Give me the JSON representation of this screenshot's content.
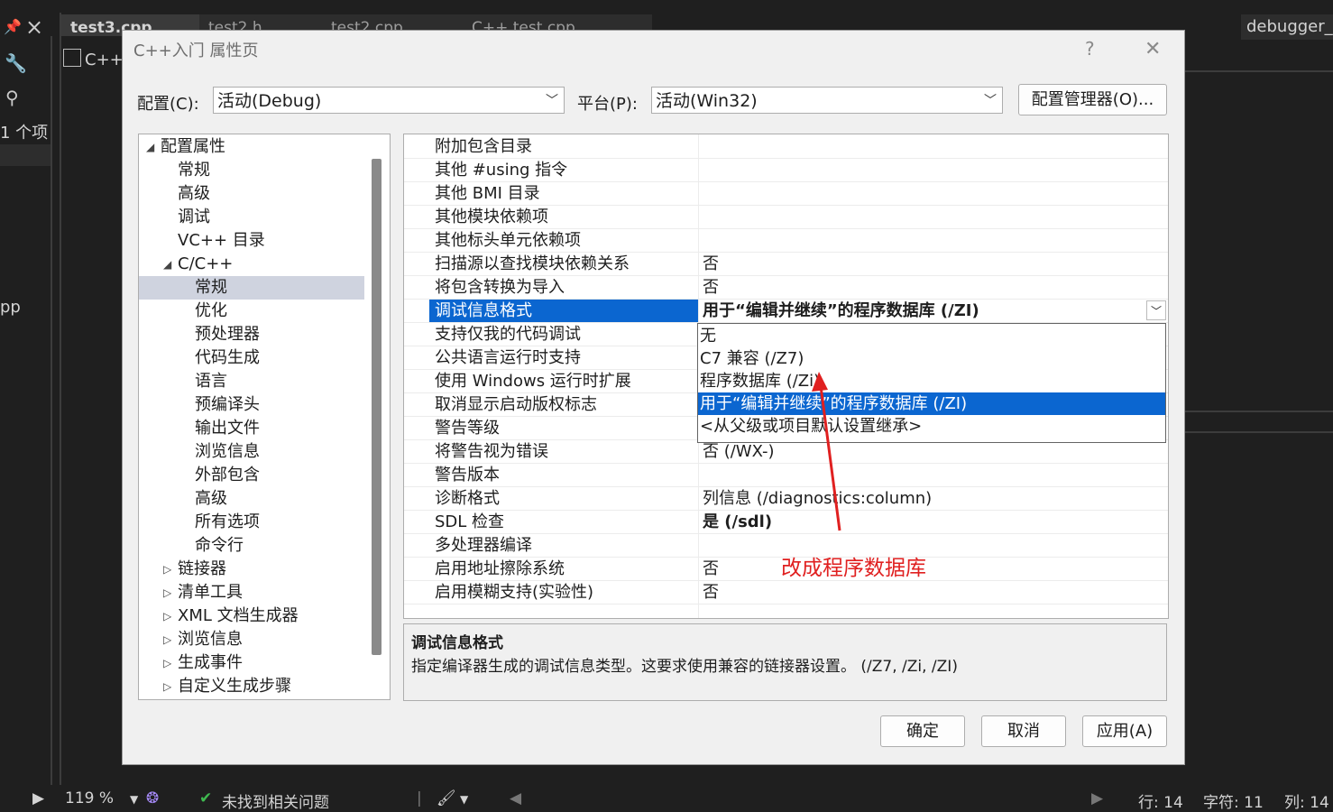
{
  "ide": {
    "tabs": [
      "test3.cpp",
      "test2.h",
      "test2.cpp",
      "C++ test.cpp"
    ],
    "active_tab": "test3.cpp",
    "pin_glyph": "⊥",
    "close_glyph": "×",
    "filename_box": "C++",
    "left_text_1": "1 个项",
    "left_text_2": "pp",
    "right_top_text": "debugger_",
    "status": {
      "zoom": "119 %",
      "issues": "未找到相关问题",
      "line": "行: 14",
      "char": "字符: 11",
      "col": "列: 14"
    }
  },
  "dialog": {
    "title": "C++入门 属性页",
    "help": "?",
    "close": "✕",
    "config_label": "配置(C):",
    "config_value": "活动(Debug)",
    "platform_label": "平台(P):",
    "platform_value": "活动(Win32)",
    "config_manager_button": "配置管理器(O)...",
    "tree": {
      "root": "配置属性",
      "items": [
        {
          "label": "常规",
          "level": 1
        },
        {
          "label": "高级",
          "level": 1
        },
        {
          "label": "调试",
          "level": 1
        },
        {
          "label": "VC++ 目录",
          "level": 1
        },
        {
          "label": "C/C++",
          "level": 1,
          "expanded": true
        },
        {
          "label": "常规",
          "level": 2,
          "selected": true
        },
        {
          "label": "优化",
          "level": 2
        },
        {
          "label": "预处理器",
          "level": 2
        },
        {
          "label": "代码生成",
          "level": 2
        },
        {
          "label": "语言",
          "level": 2
        },
        {
          "label": "预编译头",
          "level": 2
        },
        {
          "label": "输出文件",
          "level": 2
        },
        {
          "label": "浏览信息",
          "level": 2
        },
        {
          "label": "外部包含",
          "level": 2
        },
        {
          "label": "高级",
          "level": 2
        },
        {
          "label": "所有选项",
          "level": 2
        },
        {
          "label": "命令行",
          "level": 2
        },
        {
          "label": "链接器",
          "level": 1,
          "collapsed": true
        },
        {
          "label": "清单工具",
          "level": 1,
          "collapsed": true
        },
        {
          "label": "XML 文档生成器",
          "level": 1,
          "collapsed": true
        },
        {
          "label": "浏览信息",
          "level": 1,
          "collapsed": true
        },
        {
          "label": "生成事件",
          "level": 1,
          "collapsed": true
        },
        {
          "label": "自定义生成步骤",
          "level": 1,
          "collapsed": true
        }
      ]
    },
    "grid": [
      {
        "name": "附加包含目录",
        "value": ""
      },
      {
        "name": "其他 #using 指令",
        "value": ""
      },
      {
        "name": "其他 BMI 目录",
        "value": ""
      },
      {
        "name": "其他模块依赖项",
        "value": ""
      },
      {
        "name": "其他标头单元依赖项",
        "value": ""
      },
      {
        "name": "扫描源以查找模块依赖关系",
        "value": "否"
      },
      {
        "name": "将包含转换为导入",
        "value": "否"
      },
      {
        "name": "调试信息格式",
        "value": "用于“编辑并继续”的程序数据库 (/ZI)",
        "selected": true,
        "bold": true
      },
      {
        "name": "支持仅我的代码调试",
        "value": ""
      },
      {
        "name": "公共语言运行时支持",
        "value": ""
      },
      {
        "name": "使用 Windows 运行时扩展",
        "value": ""
      },
      {
        "name": "取消显示启动版权标志",
        "value": ""
      },
      {
        "name": "警告等级",
        "value": ""
      },
      {
        "name": "将警告视为错误",
        "value": "否 (/WX-)"
      },
      {
        "name": "警告版本",
        "value": ""
      },
      {
        "name": "诊断格式",
        "value": "列信息 (/diagnostics:column)"
      },
      {
        "name": "SDL 检查",
        "value": "是 (/sdl)",
        "bold": true
      },
      {
        "name": "多处理器编译",
        "value": ""
      },
      {
        "name": "启用地址擦除系统",
        "value": "否"
      },
      {
        "name": "启用模糊支持(实验性)",
        "value": "否"
      }
    ],
    "dropdown_options": [
      {
        "label": "无"
      },
      {
        "label": "C7 兼容 (/Z7)"
      },
      {
        "label": "程序数据库 (/Zi)"
      },
      {
        "label": "用于“编辑并继续”的程序数据库 (/ZI)",
        "selected": true
      },
      {
        "label": "<从父级或项目默认设置继承>"
      }
    ],
    "description": {
      "title": "调试信息格式",
      "text": "指定编译器生成的调试信息类型。这要求使用兼容的链接器设置。  (/Z7, /Zi, /ZI)"
    },
    "buttons": {
      "ok": "确定",
      "cancel": "取消",
      "apply": "应用(A)"
    }
  },
  "annotation": {
    "text": "改成程序数据库",
    "color": "#e02020"
  }
}
